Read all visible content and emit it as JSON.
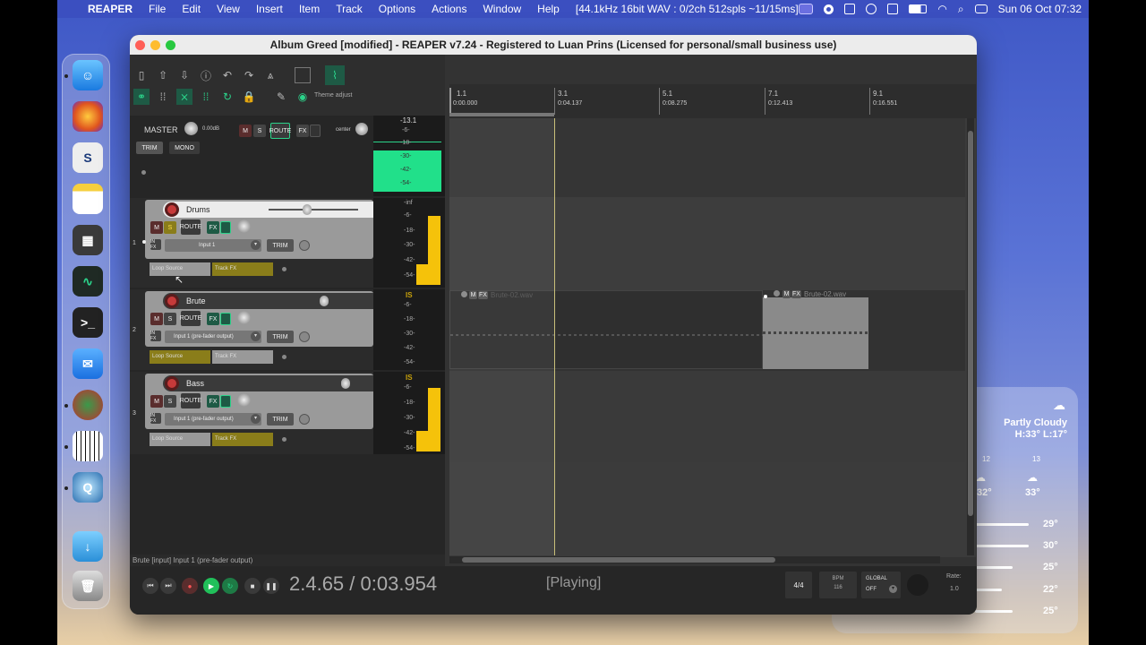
{
  "menubar": {
    "apple": "",
    "app": "REAPER",
    "items": [
      "File",
      "Edit",
      "View",
      "Insert",
      "Item",
      "Track",
      "Options",
      "Actions",
      "Window",
      "Help"
    ],
    "status": "[44.1kHz 16bit WAV : 0/2ch 512spls ~11/15ms]",
    "clock": "Sun 06 Oct  07:32"
  },
  "window": {
    "title": "Album Greed [modified] - REAPER v7.24 - Registered to Luan Prins (Licensed for personal/small business use)"
  },
  "toolbar": {
    "theme_adjust": "Theme adjust"
  },
  "master": {
    "label": "MASTER",
    "volume": "0.00dB",
    "mute": "M",
    "solo": "S",
    "route": "ROUTE",
    "fx": "FX",
    "pan": "center",
    "trim": "TRIM",
    "mono": "MONO",
    "meter_peak": "-13.1",
    "meter_scale": [
      "-6-",
      "-18-",
      "-30-",
      "-42-",
      "-54-"
    ]
  },
  "tracks": [
    {
      "num": "1",
      "name": "Drums",
      "input": "Input 1",
      "slot1": "Loop Source",
      "slot2": "Track FX",
      "scale_top": "-inf",
      "scale": [
        "-6-",
        "-18-",
        "-30-",
        "-42-",
        "-54-"
      ],
      "mute": "M",
      "solo": "S",
      "route": "ROUTE",
      "fx": "FX",
      "trim": "TRIM",
      "in_label": "IN FX"
    },
    {
      "num": "2",
      "name": "Brute",
      "input": "Input 1 (pre-fader output)",
      "slot1": "Loop Source",
      "slot2": "Track FX",
      "scale_top": "IS",
      "scale": [
        "-6-",
        "-18-",
        "-30-",
        "-42-",
        "-54-"
      ],
      "mute": "M",
      "solo": "S",
      "route": "ROUTE",
      "fx": "FX",
      "trim": "TRIM",
      "in_label": "IN FX"
    },
    {
      "num": "3",
      "name": "Bass",
      "input": "Input 1 (pre-fader output)",
      "slot1": "Loop Source",
      "slot2": "Track FX",
      "scale_top": "IS",
      "scale": [
        "-6-",
        "-18-",
        "-30-",
        "-42-",
        "-54-"
      ],
      "mute": "M",
      "solo": "S",
      "route": "ROUTE",
      "fx": "FX",
      "trim": "TRIM",
      "in_label": "IN FX"
    }
  ],
  "ruler": {
    "marks": [
      {
        "bar": "1.1",
        "time": "0:00.000"
      },
      {
        "bar": "3.1",
        "time": "0:04.137"
      },
      {
        "bar": "5.1",
        "time": "0:08.275"
      },
      {
        "bar": "7.1",
        "time": "0:12.413"
      },
      {
        "bar": "9.1",
        "time": "0:16.551"
      }
    ]
  },
  "items": {
    "item1": "Brute-02.wav",
    "item2": "Brute-02.wav",
    "m": "M",
    "fx": "FX"
  },
  "status_line": "Brute [input] Input 1 (pre-fader output)",
  "transport": {
    "position": "2.4.65 / 0:03.954",
    "state": "[Playing]",
    "timesig": "4/4",
    "bpm_label": "BPM",
    "bpm": "116",
    "global": "GLOBAL",
    "global_state": "OFF",
    "rate_label": "Rate:",
    "rate": "1.0"
  },
  "weather": {
    "condition": "Partly Cloudy",
    "hilo": "H:33° L:17°",
    "hours": [
      {
        "h": "",
        "t": "°"
      },
      {
        "h": "12",
        "t": "32°"
      },
      {
        "h": "13",
        "t": "33°"
      }
    ],
    "days": [
      "29°",
      "30°",
      "25°",
      "22°",
      "25°"
    ]
  },
  "colors": {
    "accent": "#2bd38a",
    "meter": "#f5c20a",
    "rec": "#c63a3a"
  }
}
